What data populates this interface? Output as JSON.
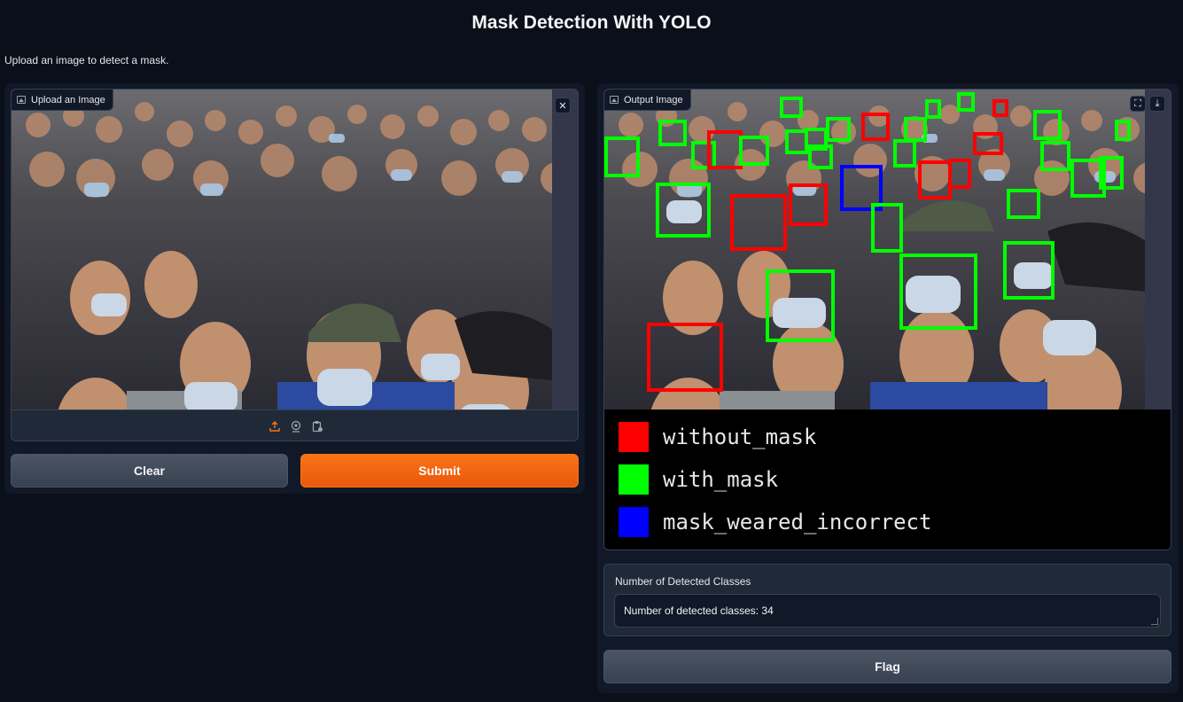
{
  "app": {
    "title": "Mask Detection With YOLO",
    "description": "Upload an image to detect a mask."
  },
  "input": {
    "label": "Upload an Image",
    "icon": "image-icon",
    "close_icon": "close-icon",
    "toolbar_icons": [
      "upload-icon",
      "webcam-icon",
      "clipboard-icon"
    ]
  },
  "buttons": {
    "clear": "Clear",
    "submit": "Submit",
    "flag": "Flag"
  },
  "output": {
    "label": "Output Image",
    "icon": "image-icon",
    "fullscreen_icon": "fullscreen-icon",
    "download_icon": "download-icon",
    "legend": [
      {
        "label": "without_mask",
        "color": "#ff0000"
      },
      {
        "label": "with_mask",
        "color": "#00ff00"
      },
      {
        "label": "mask_weared_incorrect",
        "color": "#0000ff"
      }
    ]
  },
  "result": {
    "label": "Number of Detected Classes",
    "value": "Number of detected classes: 34"
  },
  "colors": {
    "background": "#0b0f19",
    "panel": "#111827",
    "accent": "#f97316",
    "button": "#4b5563"
  }
}
